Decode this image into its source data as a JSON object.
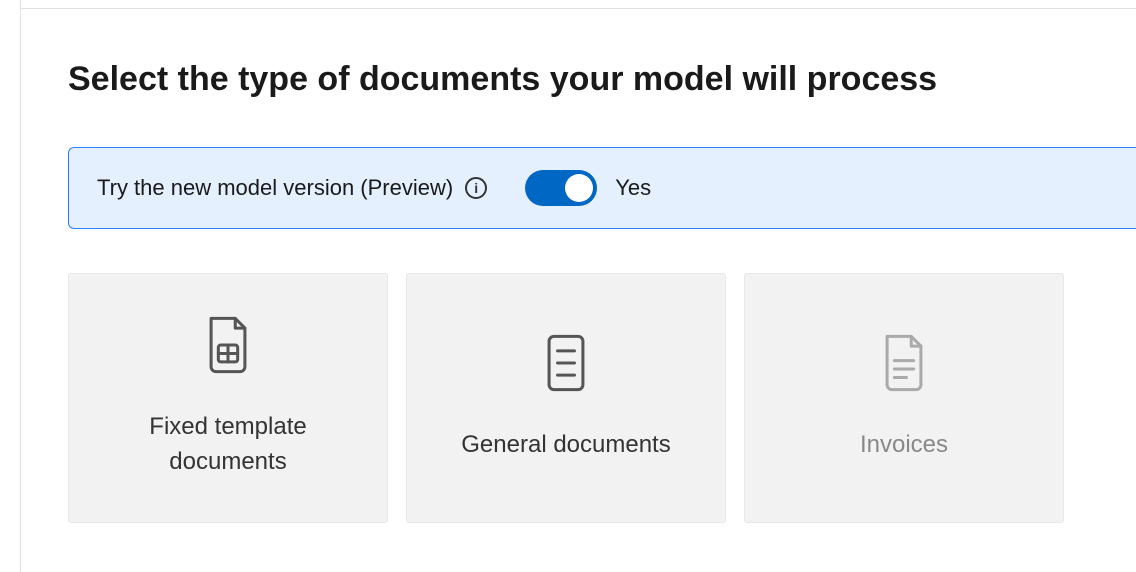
{
  "header": {
    "title": "Select the type of documents your model will process"
  },
  "preview_banner": {
    "label": "Try the new model version (Preview)",
    "toggle_state": "Yes"
  },
  "cards": {
    "fixed_template": {
      "label": "Fixed template documents"
    },
    "general": {
      "label": "General documents"
    },
    "invoices": {
      "label": "Invoices"
    }
  }
}
